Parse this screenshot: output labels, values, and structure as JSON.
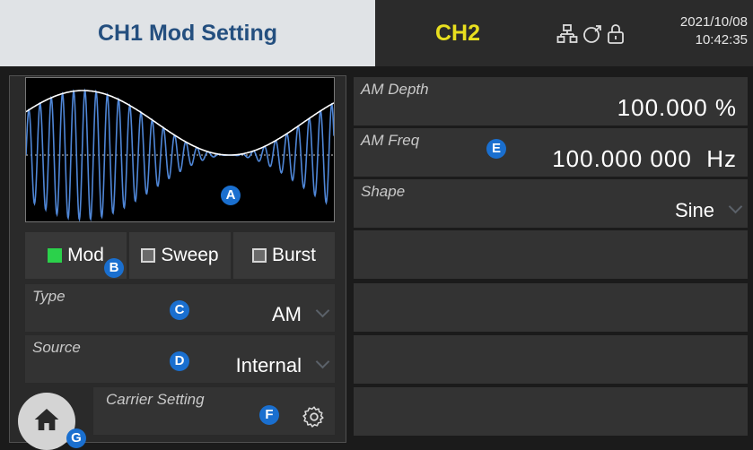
{
  "header": {
    "tab_ch1": "CH1 Mod Setting",
    "tab_ch2": "CH2",
    "date": "2021/10/08",
    "time": "10:42:35",
    "icons": [
      "network-icon",
      "usb-icon",
      "lock-icon"
    ]
  },
  "mode_buttons": [
    {
      "label": "Mod",
      "checked": true
    },
    {
      "label": "Sweep",
      "checked": false
    },
    {
      "label": "Burst",
      "checked": false
    }
  ],
  "left_fields": {
    "type": {
      "label": "Type",
      "value": "AM"
    },
    "source": {
      "label": "Source",
      "value": "Internal"
    },
    "carrier": {
      "label": "Carrier Setting"
    }
  },
  "right_fields": {
    "am_depth": {
      "label": "AM Depth",
      "value": "100.000 %"
    },
    "am_freq": {
      "label": "AM Freq",
      "value": "100.000 000  Hz"
    },
    "shape": {
      "label": "Shape",
      "value": "Sine"
    }
  },
  "badges": {
    "a": "A",
    "b": "B",
    "c": "C",
    "d": "D",
    "e": "E",
    "f": "F",
    "g": "G"
  },
  "colors": {
    "tab_active_bg": "#e0e3e6",
    "tab_active_text": "#244f7f",
    "ch2_text": "#e8df1f",
    "checked": "#2bd14b",
    "badge": "#1a6fcf",
    "waveform": "#4f86d6"
  }
}
